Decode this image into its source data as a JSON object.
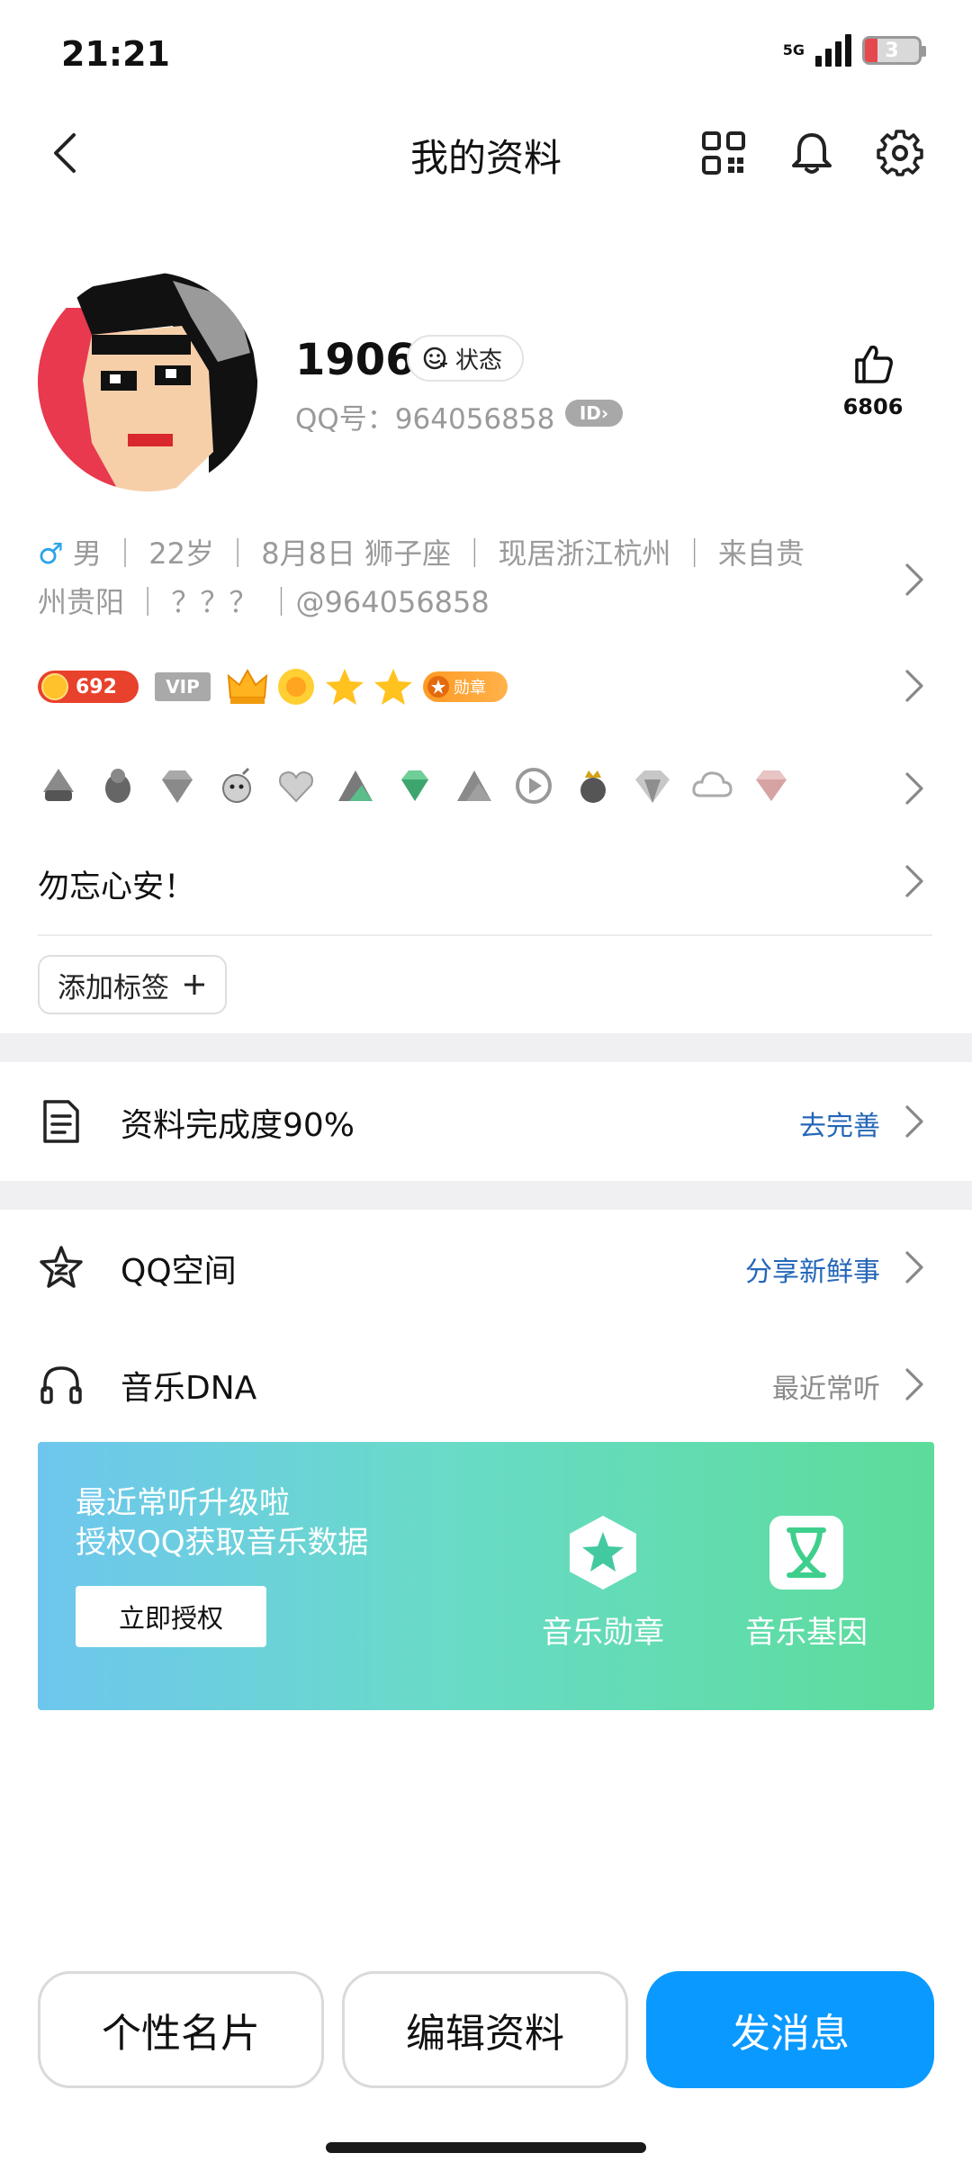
{
  "status_bar": {
    "time": "21:21",
    "network": "5G",
    "battery": "3"
  },
  "nav": {
    "title": "我的资料"
  },
  "profile": {
    "nickname": "1906",
    "status_label": "状态",
    "qq_number": "QQ号：964056858",
    "id_badge": "ID",
    "like_count": "6806"
  },
  "info": {
    "gender_symbol": "♂",
    "line": "男 ｜ 22岁 ｜ 8月8日  狮子座 ｜ 现居浙江杭州 ｜ 来自贵州贵阳 ｜ ？？？  ｜@964056858"
  },
  "badges": {
    "coin_level": "692",
    "vip": "VIP",
    "medal": "勋章"
  },
  "signature": "勿忘心安！",
  "add_tag_label": "添加标签",
  "completion": {
    "label": "资料完成度90%",
    "action": "去完善"
  },
  "qzone": {
    "label": "QQ空间",
    "action": "分享新鲜事"
  },
  "music": {
    "label": "音乐DNA",
    "action": "最近常听",
    "card_line1": "最近常听升级啦",
    "card_line2": "授权QQ获取音乐数据",
    "auth_button": "立即授权",
    "feature_medal": "音乐勋章",
    "feature_gene": "音乐基因"
  },
  "bottom": {
    "card_button": "个性名片",
    "edit_button": "编辑资料",
    "message_button": "发消息"
  },
  "colors": {
    "accent_blue": "#0a99ff",
    "link_blue": "#2466b8",
    "male_blue": "#2aa4e8",
    "muted_gray": "#9a9a9a"
  }
}
